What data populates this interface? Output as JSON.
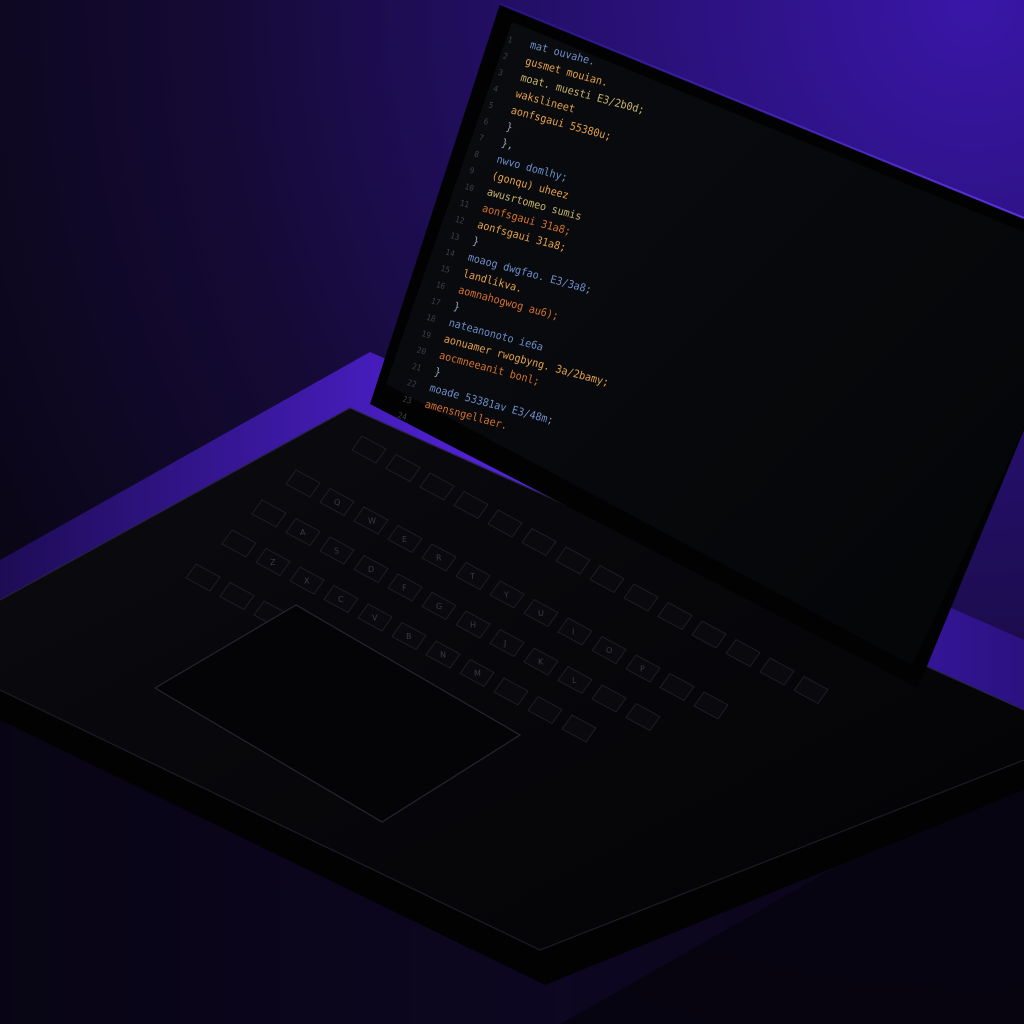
{
  "scene": {
    "subject": "laptop",
    "colors": {
      "background_top": "#3a16a8",
      "background_glow": "#6a2bff",
      "background_dark": "#07050f",
      "laptop_body": "#050507",
      "screen_bg": "#060709",
      "keyboard_keys": "#0a0a0e"
    }
  },
  "editor": {
    "line_numbers": [
      "1",
      "2",
      "3",
      "4",
      "5",
      "6",
      "7",
      "8",
      "9",
      "10",
      "11",
      "12",
      "13",
      "14",
      "15",
      "16",
      "17",
      "18",
      "19",
      "20",
      "21",
      "22",
      "23",
      "24"
    ],
    "syntax_colors": {
      "keyword": "#6e8fc9",
      "string": "#e6a24a",
      "value": "#c8b46a",
      "punct": "#9aa3b8",
      "orange": "#d8722e"
    },
    "lines": [
      {
        "text": "mat ouvahe.",
        "color": "#6e8fc9"
      },
      {
        "text": "  gusmet mouian.",
        "color": "#e6a24a"
      },
      {
        "text": "    moat. muesti E3/2b0d;",
        "color": "#c8b46a"
      },
      {
        "text": "      wakslineet",
        "color": "#e6a24a"
      },
      {
        "text": "      aonfsgaui 55380u;",
        "color": "#e6a24a"
      },
      {
        "text": "  }",
        "color": "#9aa3b8"
      },
      {
        "text": "  },",
        "color": "#9aa3b8"
      },
      {
        "text": "nwvo domlhy;",
        "color": "#6e8fc9"
      },
      {
        "text": "  (gonqu) uheez",
        "color": "#e6a24a"
      },
      {
        "text": "  awusrtomeo sumis",
        "color": "#c8b46a"
      },
      {
        "text": "  aonfsgaui 31a8;",
        "color": "#d8722e"
      },
      {
        "text": "  aonfsgaui 31a8;",
        "color": "#e6a24a"
      },
      {
        "text": "}",
        "color": "#9aa3b8"
      },
      {
        "text": "moaog dwgfao. E3/3a8;",
        "color": "#6e8fc9"
      },
      {
        "text": "  landlikva.",
        "color": "#e6a24a"
      },
      {
        "text": "  aomnahogwog au6);",
        "color": "#d8722e"
      },
      {
        "text": "}",
        "color": "#9aa3b8"
      },
      {
        "text": "nateanonoto ie6a",
        "color": "#6e8fc9"
      },
      {
        "text": "  aonuamer rwogbyng. 3a/2bamy;",
        "color": "#e6a24a"
      },
      {
        "text": "  aocmneeanit bonl;",
        "color": "#d8722e"
      },
      {
        "text": "}",
        "color": "#9aa3b8"
      },
      {
        "text": "moade 53381av E3/48m;",
        "color": "#6e8fc9"
      },
      {
        "text": "  amensngellaer.",
        "color": "#d8722e"
      },
      {
        "text": "",
        "color": "#9aa3b8"
      }
    ]
  },
  "keyboard": {
    "rows": [
      {
        "keys": [
          "",
          "",
          "",
          "",
          "",
          "",
          "",
          "",
          "",
          "",
          "",
          "",
          "",
          ""
        ]
      },
      {
        "keys": [
          "",
          "Q",
          "W",
          "E",
          "R",
          "T",
          "Y",
          "U",
          "I",
          "O",
          "P",
          "",
          ""
        ]
      },
      {
        "keys": [
          "",
          "A",
          "S",
          "D",
          "F",
          "G",
          "H",
          "J",
          "K",
          "L",
          "",
          ""
        ]
      },
      {
        "keys": [
          "",
          "Z",
          "X",
          "C",
          "V",
          "B",
          "N",
          "M",
          "",
          "",
          ""
        ]
      },
      {
        "keys": [
          "",
          "",
          "",
          "",
          "",
          "",
          ""
        ]
      }
    ]
  }
}
